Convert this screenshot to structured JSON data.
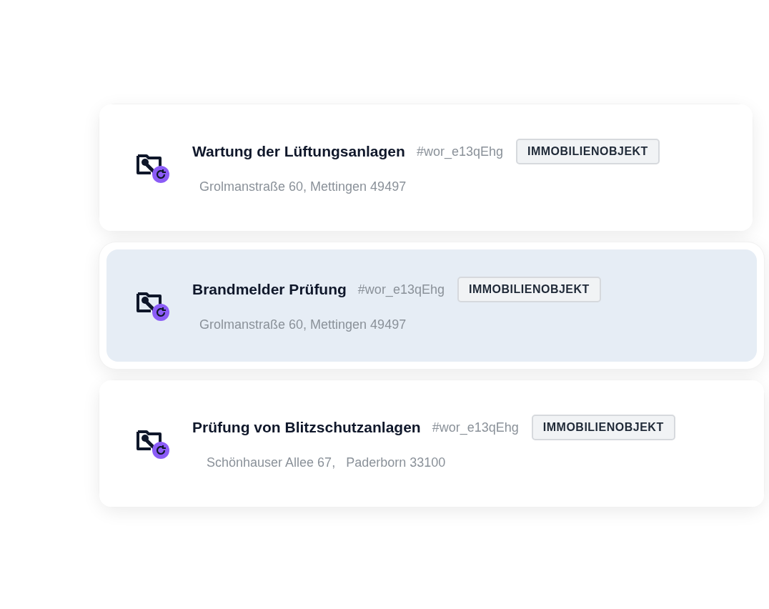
{
  "items": [
    {
      "title": "Wartung der Lüftungsanlagen",
      "code": "#wor_e13qEhg",
      "tag": "IMMOBILIENOBJEKT",
      "address": "Grolmanstraße 60, Mettingen 49497",
      "selected": false
    },
    {
      "title": "Brandmelder Prüfung",
      "code": "#wor_e13qEhg",
      "tag": "IMMOBILIENOBJEKT",
      "address": "Grolmanstraße 60, Mettingen 49497",
      "selected": true
    },
    {
      "title": "Prüfung von Blitzschutzanlagen",
      "code": "#wor_e13qEhg",
      "tag": "IMMOBILIENOBJEKT",
      "address": "Schönhauser Allee 67,   Paderborn 33100",
      "selected": false
    }
  ]
}
